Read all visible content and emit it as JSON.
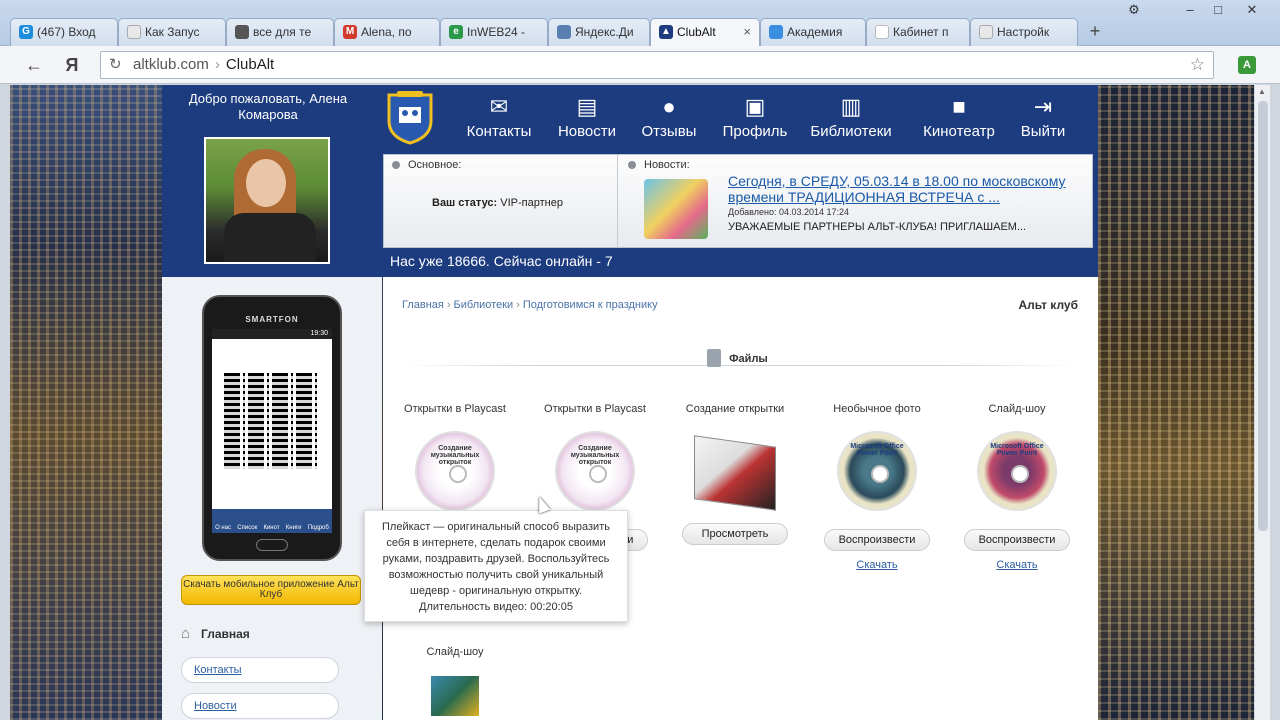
{
  "browser": {
    "tabs": [
      {
        "label": "(467) Вход",
        "fav_color": "#1f8ddd",
        "fav_glyph": "G"
      },
      {
        "label": "Как Запус",
        "fav_color": "#999999",
        "fav_glyph": ""
      },
      {
        "label": "все для те",
        "fav_color": "#555555",
        "fav_glyph": ""
      },
      {
        "label": "Alena, по",
        "fav_color": "#d33b2c",
        "fav_glyph": "M"
      },
      {
        "label": "InWEB24 -",
        "fav_color": "#2a9a4a",
        "fav_glyph": "e"
      },
      {
        "label": "Яндекс.Ди",
        "fav_color": "#5a7fb0",
        "fav_glyph": ""
      },
      {
        "label": "ClubAlt",
        "fav_color": "#1d3c80",
        "fav_glyph": "▲",
        "active": true
      },
      {
        "label": "Академия",
        "fav_color": "#3b8ee0",
        "fav_glyph": ""
      },
      {
        "label": "Кабинет п",
        "fav_color": "#ffffff",
        "fav_glyph": ""
      },
      {
        "label": "Настройк",
        "fav_color": "#999999",
        "fav_glyph": ""
      }
    ],
    "address": {
      "host": "altklub.com",
      "title": "ClubAlt"
    },
    "back_glyph": "←",
    "yandex_glyph": "Я",
    "reload_glyph": "↻",
    "star_glyph": "☆"
  },
  "header": {
    "welcome": "Добро пожаловать, Алена Комарова",
    "nav": [
      {
        "label": "Контакты",
        "icon": "mail-icon",
        "glyph": "✉"
      },
      {
        "label": "Новости",
        "icon": "news-icon",
        "glyph": "▤"
      },
      {
        "label": "Отзывы",
        "icon": "chat-icon",
        "glyph": "●"
      },
      {
        "label": "Профиль",
        "icon": "profile-icon",
        "glyph": "▣"
      },
      {
        "label": "Библиотеки",
        "icon": "library-icon",
        "glyph": "▥"
      },
      {
        "label": "Кинотеатр",
        "icon": "camera-icon",
        "glyph": "■"
      },
      {
        "label": "Выйти",
        "icon": "logout-icon",
        "glyph": "⇥"
      }
    ],
    "info": {
      "basic_label": "Основное:",
      "status_label": "Ваш статус:",
      "status_value": "VIP-партнер",
      "news_label": "Новости:",
      "news_link": "Сегодня, в СРЕДУ, 05.03.14 в 18.00 по московскому времени ТРАДИЦИОННАЯ ВСТРЕЧА с ...",
      "news_date": "Добавлено: 04.03.2014 17:24",
      "news_text": "УВАЖАЕМЫЕ ПАРТНЕРЫ АЛЬТ-КЛУБА! ПРИГЛАШАЕМ..."
    },
    "online": "Нас уже 18666. Сейчас онлайн - 7"
  },
  "sidebar": {
    "phone_brand": "SMARTFON",
    "phone_time": "19:30",
    "phone_dock": [
      "О нас",
      "Список",
      "Кинот",
      "Книги",
      "Подроб"
    ],
    "download_app": "Скачать мобильное приложение Альт Клуб",
    "home": "Главная",
    "links": [
      "Контакты",
      "Новости"
    ]
  },
  "main": {
    "breadcrumb": [
      "Главная",
      "Библиотеки",
      "Подготовимся к празднику"
    ],
    "site_name": "Альт клуб",
    "files_title": "Файлы",
    "items": [
      {
        "title": "Открытки в Playcast",
        "disc_text": "Создание музыкальных открыток",
        "button": "",
        "download": ""
      },
      {
        "title": "Открытки в Playcast",
        "disc_text": "Создание музыкальных открыток",
        "button": "Воспроизвести",
        "download": ""
      },
      {
        "title": "Создание открытки",
        "disc_text": "",
        "button": "Просмотреть",
        "download": ""
      },
      {
        "title": "Необычное фото",
        "disc_text": "Microsoft Office Power Point",
        "button": "Воспроизвести",
        "download": "Скачать"
      },
      {
        "title": "Слайд-шоу",
        "disc_text": "Microsoft Office Power Point",
        "button": "Воспроизвести",
        "download": "Скачать"
      }
    ],
    "row2": [
      {
        "title": "Слайд-шоу"
      }
    ],
    "tooltip": "Плейкаст — оригинальный способ выразить себя в интернете, сделать подарок своими руками, поздравить друзей. Воспользуйтесь возможностью получить свой уникальный шедевр - оригинальную открытку. Длительность видео: 00:20:05"
  },
  "colors": {
    "header_bg": "#1d3c80",
    "link": "#2a5ea0",
    "app_button": "#f2b800"
  }
}
